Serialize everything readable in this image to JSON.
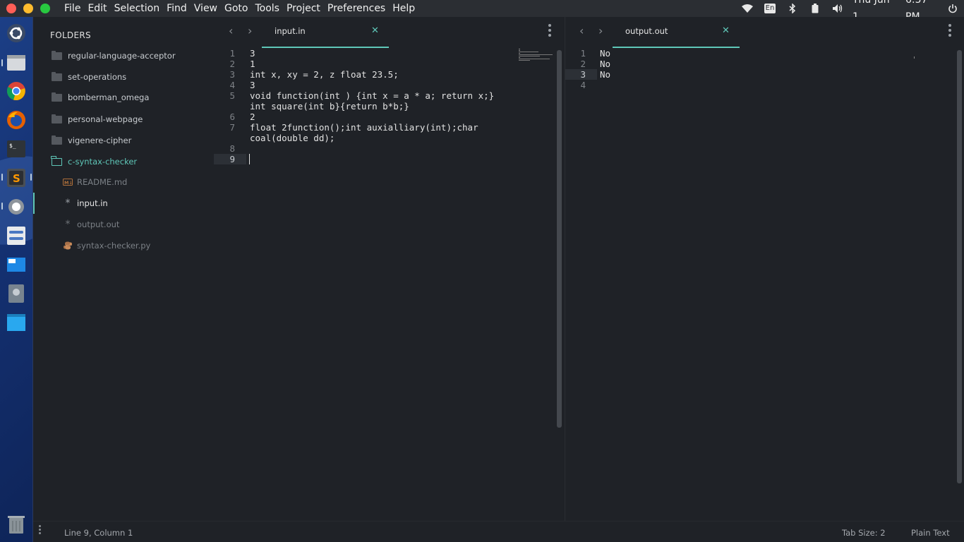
{
  "menubar": {
    "items": [
      "File",
      "Edit",
      "Selection",
      "Find",
      "View",
      "Goto",
      "Tools",
      "Project",
      "Preferences",
      "Help"
    ],
    "tray": {
      "keyboard_layout": "En",
      "date": "Thu Jun  1",
      "time": "6:57 PM"
    },
    "window_button_colors": [
      "#ff5f57",
      "#febc2e",
      "#28c840"
    ]
  },
  "dock": {
    "items": [
      "ubuntu-logo-icon",
      "files-icon",
      "chrome-icon",
      "firefox-icon",
      "terminal-icon",
      "sublime-text-icon",
      "settings-gear-icon",
      "system-settings-icon",
      "window-manager-icon",
      "disk-utility-icon",
      "file-manager-icon",
      "trash-icon"
    ]
  },
  "sidebar": {
    "title": "FOLDERS",
    "folders": [
      {
        "name": "regular-language-acceptor"
      },
      {
        "name": "set-operations"
      },
      {
        "name": "bomberman_omega"
      },
      {
        "name": "personal-webpage"
      },
      {
        "name": "vigenere-cipher"
      },
      {
        "name": "c-syntax-checker"
      }
    ],
    "files": [
      {
        "name": "README.md",
        "icon": "markdown-icon"
      },
      {
        "name": "input.in",
        "icon": "asterisk-icon",
        "selected": true
      },
      {
        "name": "output.out",
        "icon": "asterisk-icon"
      },
      {
        "name": "syntax-checker.py",
        "icon": "python-icon"
      }
    ]
  },
  "editor_left": {
    "tab_label": "input.in",
    "line_numbers": [
      "1",
      "2",
      "3",
      "4",
      "5",
      "",
      "6",
      "7",
      "",
      "8",
      "9"
    ],
    "lines": [
      "3",
      "1",
      "int x, xy = 2, z float 23.5;",
      "3",
      "void function(int ) {int x = a * a; return x;}",
      "int square(int b}{return b*b;}",
      "2",
      "float 2function();int auxialliary(int);char",
      "coal(double dd);",
      "",
      ""
    ]
  },
  "editor_right": {
    "tab_label": "output.out",
    "line_numbers": [
      "1",
      "2",
      "3",
      "4"
    ],
    "lines": [
      "No",
      "No",
      "No",
      ""
    ]
  },
  "statusbar": {
    "position": "Line 9, Column 1",
    "tab_size": "Tab Size: 2",
    "syntax": "Plain Text"
  },
  "accent_color": "#5fc7b8"
}
